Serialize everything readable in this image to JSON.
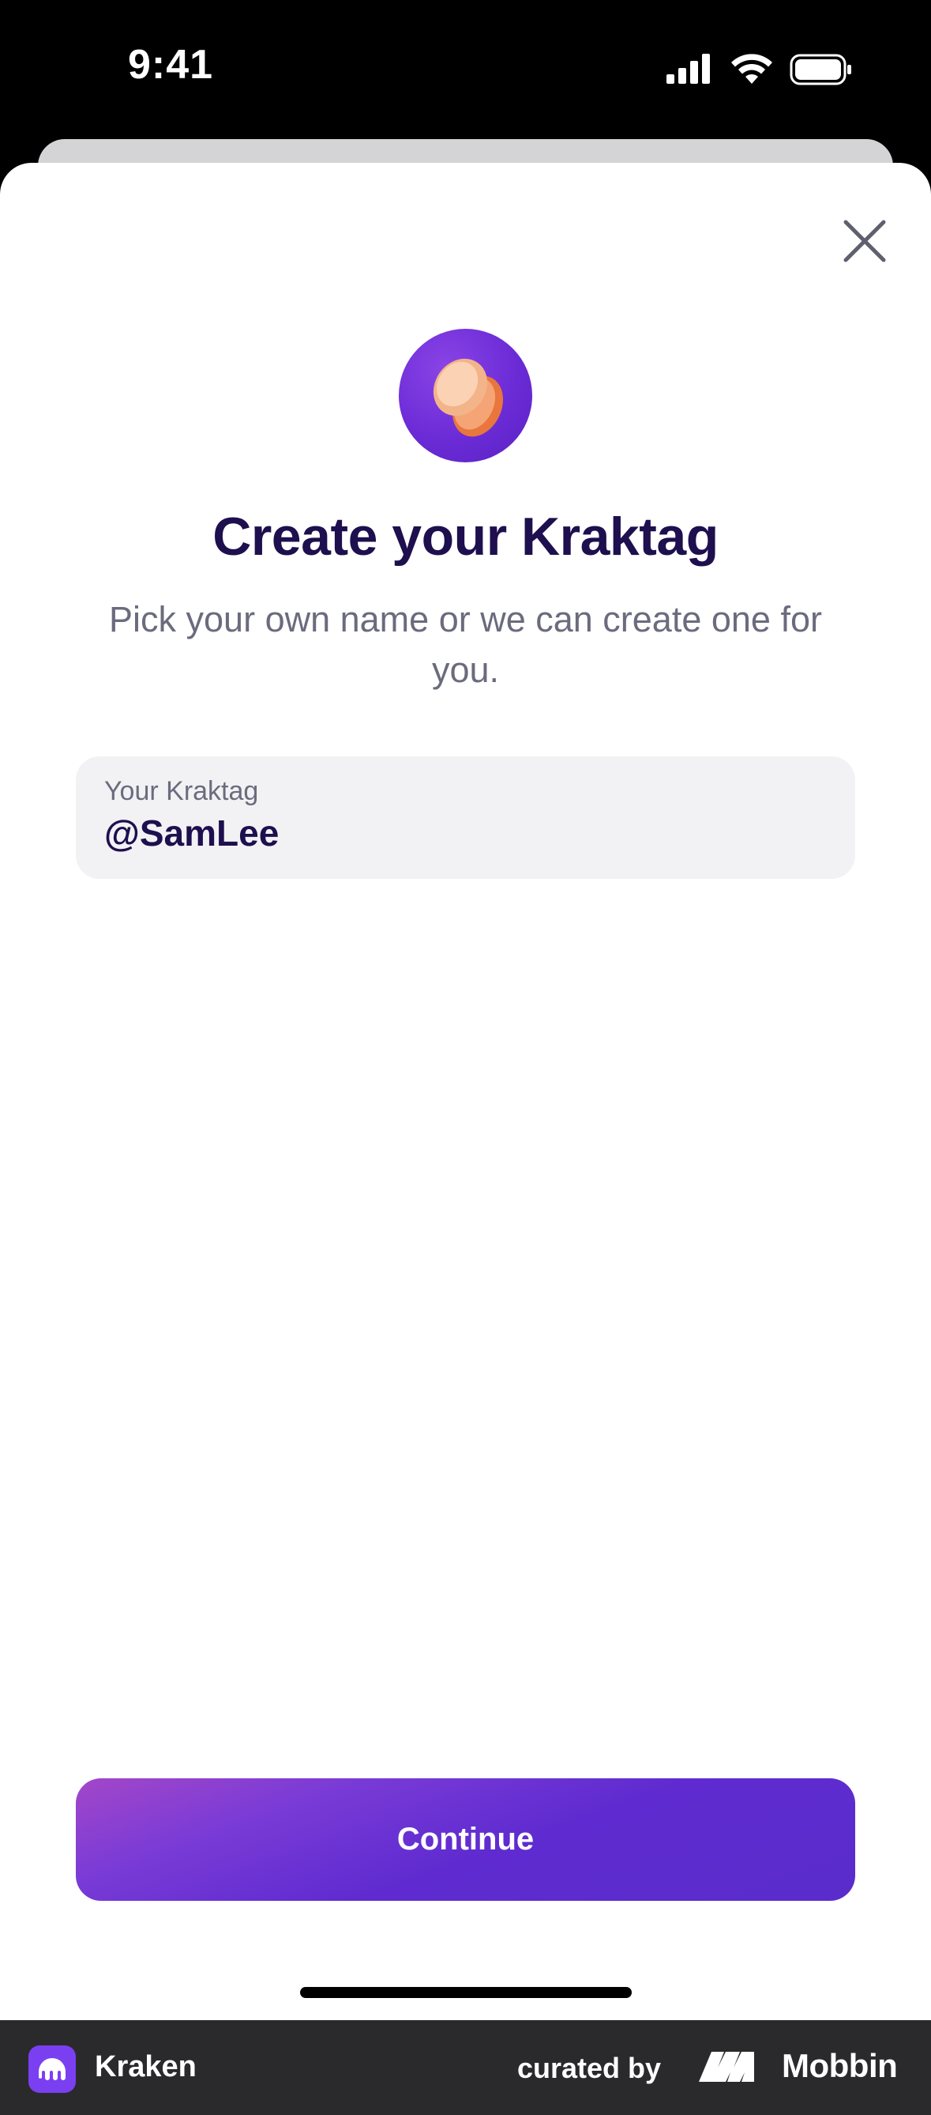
{
  "status_bar": {
    "time": "9:41",
    "icons": [
      "cellular-signal-icon",
      "wifi-icon",
      "battery-icon"
    ]
  },
  "sheet": {
    "close_icon": "close-icon",
    "hero_icon": "kraktag-avatar-icon",
    "title": "Create your Kraktag",
    "subtitle": "Pick your own name or we can create one for you.",
    "input": {
      "label": "Your Kraktag",
      "value": "@SamLee"
    },
    "continue_label": "Continue"
  },
  "footer": {
    "app_name": "Kraken",
    "curated_by": "curated by",
    "brand": "Mobbin"
  },
  "colors": {
    "title": "#1e0f4e",
    "accent_start": "#a347c9",
    "accent_end": "#5a2ccb",
    "subtitle": "#6b6b7e",
    "input_bg": "#f2f2f4"
  }
}
